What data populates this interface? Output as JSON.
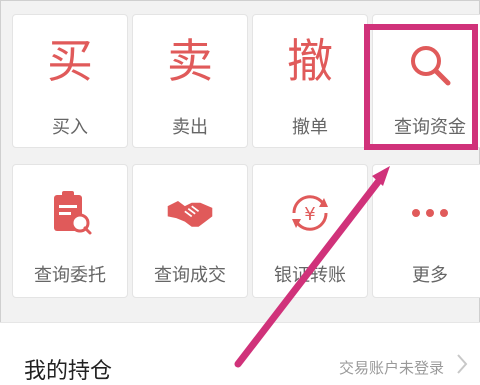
{
  "grid": {
    "row1": [
      {
        "glyph": "买",
        "label": "买入"
      },
      {
        "glyph": "卖",
        "label": "卖出"
      },
      {
        "glyph": "撤",
        "label": "撤单"
      },
      {
        "label": "查询资金",
        "icon": "search-icon"
      }
    ],
    "row2": [
      {
        "label": "查询委托",
        "icon": "clipboard-search-icon"
      },
      {
        "label": "查询成交",
        "icon": "handshake-icon"
      },
      {
        "label": "银证转账",
        "icon": "yen-transfer-icon"
      },
      {
        "label": "更多",
        "icon": "more-dots-icon"
      }
    ]
  },
  "holdings": {
    "title": "我的持仓",
    "status": "交易账户未登录"
  },
  "colors": {
    "accent": "#e05a5a",
    "highlight": "#d0327a",
    "arrow": "#d0327a"
  }
}
